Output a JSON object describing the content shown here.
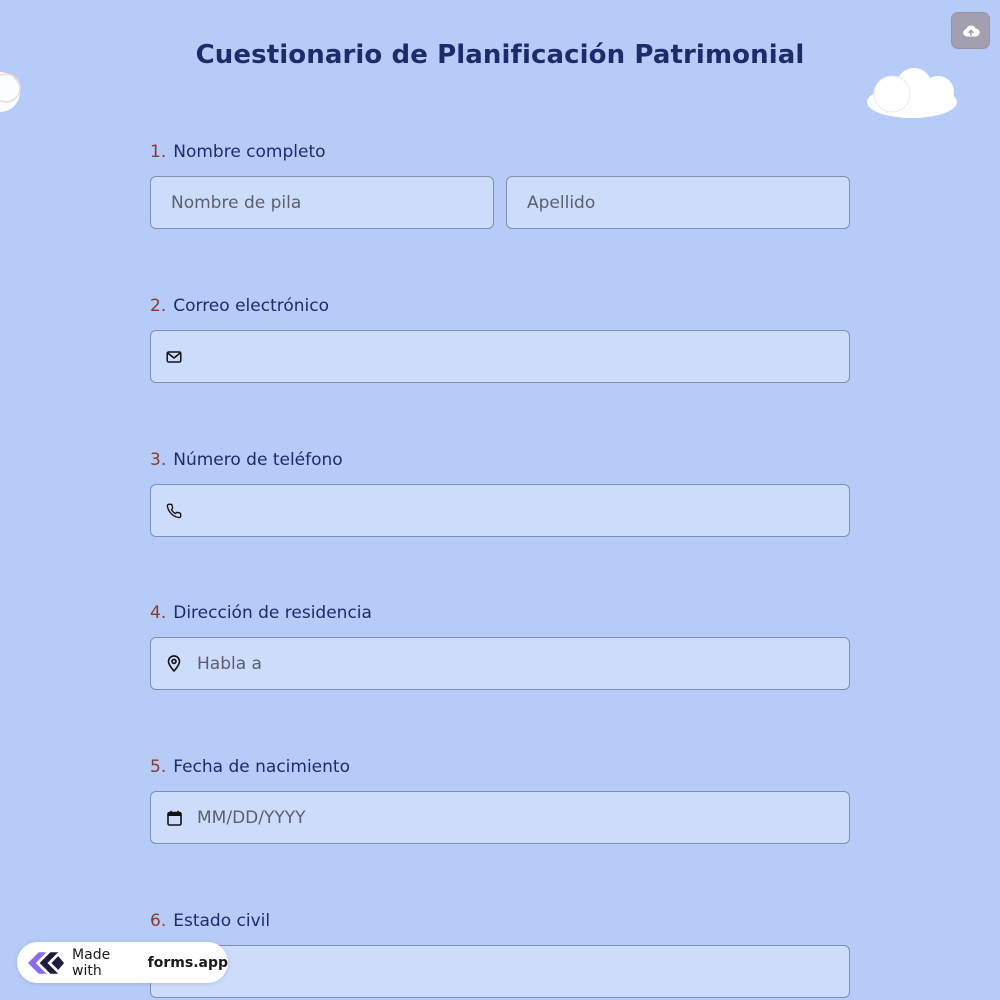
{
  "form": {
    "title": "Cuestionario de Planificación Patrimonial"
  },
  "questions": [
    {
      "number": "1.",
      "label": "Nombre completo",
      "first_name_placeholder": "Nombre de pila",
      "last_name_placeholder": "Apellido"
    },
    {
      "number": "2.",
      "label": "Correo electrónico",
      "icon": "mail-icon",
      "placeholder": ""
    },
    {
      "number": "3.",
      "label": "Número de teléfono",
      "icon": "phone-icon",
      "placeholder": ""
    },
    {
      "number": "4.",
      "label": "Dirección de residencia",
      "icon": "location-pin-icon",
      "placeholder": "Habla a"
    },
    {
      "number": "5.",
      "label": "Fecha de nacimiento",
      "icon": "calendar-icon",
      "placeholder": "MM/DD/YYYY"
    },
    {
      "number": "6.",
      "label": "Estado civil",
      "placeholder": ""
    }
  ],
  "badge": {
    "made_with": "Made with",
    "brand": "forms.app"
  },
  "colors": {
    "background": "#b6cbf8",
    "field_background": "#cddcfb",
    "title_text": "#1c2c6b",
    "question_number": "#8b3a2a",
    "upload_button": "#a39fb0"
  },
  "icons": {
    "upload": "cloud-upload-icon",
    "brand_logo": "forms-app-logo"
  }
}
